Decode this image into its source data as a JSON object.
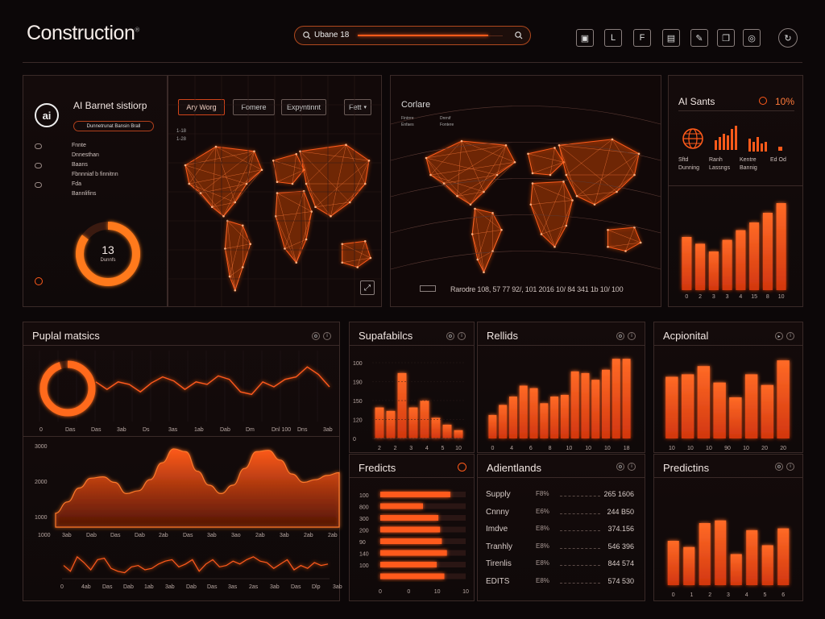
{
  "app": {
    "title": "Construction",
    "title_mark": "®",
    "search_value": "Ubane 18",
    "colors": {
      "accent": "#ff5a1a",
      "bg": "#0c0708",
      "panel_border": "#3a2a28"
    },
    "toolbar_icons": [
      "document-icon",
      "corner-icon",
      "grid-icon",
      "download-icon",
      "pen-icon",
      "copy-icon",
      "search-circle-icon",
      "refresh-icon"
    ]
  },
  "sidebar": {
    "title": "AI Barnet sistiorp",
    "badge": "Dunnetrunat Bansin Brall",
    "items": [
      {
        "label": "Fnnte",
        "icon": "play-icon"
      },
      {
        "label": "Dnnesthan",
        "icon": "none"
      },
      {
        "label": "Baans",
        "icon": "link-icon"
      },
      {
        "label": "Fbnnniaf b finnitnn",
        "icon": "none"
      },
      {
        "label": "Fda",
        "icon": "link-icon"
      },
      {
        "label": "Bannlifins",
        "icon": "none"
      }
    ],
    "donut_value": "13",
    "donut_sub": "Dunnfs",
    "donut_fraction": 0.85
  },
  "map_left": {
    "tabs": [
      "Ary Worg",
      "Fomere",
      "Expyntinnt",
      "Fett"
    ],
    "legend": [
      "1-18",
      "1-28"
    ]
  },
  "map_center": {
    "title": "Corlare",
    "legend": [
      "Fintnre",
      "Dnrnif",
      "Enfaes",
      "Fontere"
    ],
    "footer": "Rarodre 108, 57 77 92/, 101 2016 10/ 84 341 1b 10/ 100"
  },
  "ai_stats": {
    "title": "AI Sants",
    "percent": "10%",
    "stats": [
      {
        "label": "Sftd Dunning",
        "icon": "globe-icon"
      },
      {
        "label": "Ranh Lassngs",
        "icon": "bars-icon"
      },
      {
        "label": "Kentre Bannig",
        "icon": "bars-icon"
      },
      {
        "label": "Ed Od",
        "icon": "bars-icon"
      }
    ],
    "chart_data": {
      "type": "bar",
      "categories": [
        "0",
        "2",
        "3",
        "3",
        "4",
        "15",
        "8",
        "10"
      ],
      "values": [
        55,
        48,
        40,
        52,
        62,
        70,
        80,
        90
      ],
      "ylim": [
        0,
        100
      ],
      "xlabel": "",
      "ylabel": ""
    }
  },
  "pupial": {
    "title": "Puplal matsics",
    "donut_fraction": 0.95,
    "top_ticks": [
      "0",
      "Das",
      "Das",
      "3ab",
      "Ds",
      "3as",
      "1ab",
      "Dab",
      "Dm",
      "Dnl 100",
      "Dns",
      "3ab"
    ],
    "top_line": [
      60,
      45,
      60,
      55,
      40,
      58,
      70,
      62,
      45,
      60,
      55,
      72,
      65,
      40,
      35,
      60,
      50,
      65,
      70,
      90,
      75,
      50
    ],
    "area_y_ticks": [
      "3000",
      "2000",
      "1000"
    ],
    "area_ticks": [
      "1000",
      "3ab",
      "Dab",
      "Das",
      "Dab",
      "2ab",
      "Das",
      "3ab",
      "3ao",
      "2ab",
      "3ab",
      "2ab",
      "2ab"
    ],
    "chart_data": {
      "type": "area",
      "x": [
        0,
        1,
        2,
        3,
        4,
        5,
        6,
        7,
        8,
        9,
        10,
        11,
        12,
        13,
        14,
        15,
        16,
        17,
        18,
        19,
        20,
        21,
        22,
        23,
        24
      ],
      "values": [
        500,
        900,
        1400,
        1750,
        1800,
        1600,
        1200,
        1300,
        1700,
        2300,
        2800,
        2700,
        2000,
        1500,
        1200,
        1500,
        2100,
        2700,
        2750,
        2400,
        1900,
        1600,
        1700,
        1850,
        1950
      ],
      "ylim": [
        0,
        3000
      ],
      "xlabel": "",
      "ylabel": ""
    },
    "bottom_line": [
      40,
      20,
      70,
      50,
      25,
      60,
      65,
      30,
      20,
      15,
      35,
      40,
      25,
      30,
      45,
      55,
      60,
      35,
      45,
      60,
      20,
      45,
      60,
      35,
      40,
      55,
      45,
      60,
      70,
      55,
      50,
      30,
      45,
      60,
      25,
      40,
      30,
      50,
      40,
      45
    ],
    "bottom_ticks": [
      "0",
      "4ab",
      "Das",
      "Dab",
      "1ab",
      "3ab",
      "Dab",
      "Das",
      "3as",
      "2as",
      "3ab",
      "Das",
      "Dlp",
      "3ab"
    ]
  },
  "supafabits": {
    "title": "Supafabilcs",
    "y_ticks": [
      "100",
      "190",
      "150",
      "120",
      "0"
    ],
    "chart_data": {
      "type": "bar",
      "categories": [
        "2",
        "2",
        "3",
        "3",
        "4",
        "5",
        "10"
      ],
      "values": [
        45,
        40,
        95,
        45,
        55,
        30,
        20,
        12
      ],
      "ylim": [
        0,
        110
      ],
      "xlabel": "",
      "ylabel": ""
    },
    "x_labels": [
      "2",
      "2",
      "3",
      "4",
      "5",
      "10"
    ]
  },
  "rellids": {
    "title": "Rellids",
    "chart_data": {
      "type": "bar",
      "categories": [
        "0",
        "4",
        "6",
        "8",
        "10",
        "10",
        "10",
        "18"
      ],
      "values": [
        28,
        40,
        50,
        63,
        60,
        42,
        50,
        52,
        80,
        78,
        70,
        82,
        95,
        95
      ],
      "ylim": [
        0,
        100
      ],
      "xlabel": "",
      "ylabel": ""
    },
    "x_labels": [
      "0",
      "4",
      "6",
      "8",
      "10",
      "10",
      "10",
      "18"
    ]
  },
  "acpionital": {
    "title": "Acpionital",
    "chart_data": {
      "type": "bar",
      "categories": [
        "10",
        "10",
        "10",
        "90",
        "10",
        "20",
        "30"
      ],
      "values": [
        75,
        78,
        88,
        68,
        50,
        78,
        65,
        95
      ],
      "ylim": [
        0,
        100
      ],
      "xlabel": "",
      "ylabel": ""
    },
    "x_labels": [
      "10",
      "10",
      "10",
      "90",
      "10",
      "20",
      "20"
    ]
  },
  "fredicts": {
    "title": "Fredicts",
    "rows": [
      "100",
      "800",
      "300",
      "200",
      "90",
      "140",
      "100"
    ],
    "chart_data": {
      "type": "bar",
      "categories": [
        "100",
        "800",
        "300",
        "200",
        "90",
        "140",
        "100"
      ],
      "values": [
        0.82,
        0.5,
        0.68,
        0.7,
        0.72,
        0.78,
        0.66,
        0.75
      ],
      "xlim": [
        0,
        1
      ],
      "xlabel": "",
      "ylabel": ""
    },
    "x_labels": [
      "0",
      "0",
      "10",
      "10"
    ]
  },
  "adientlands": {
    "title": "Adientlands",
    "rows": [
      {
        "name": "Supply",
        "mid": "F8%",
        "value": "265 1606"
      },
      {
        "name": "Cnnny",
        "mid": "E6%",
        "value": "244 B50"
      },
      {
        "name": "Imdve",
        "mid": "E8%",
        "value": "374.156"
      },
      {
        "name": "Tranhly",
        "mid": "E8%",
        "value": "546 396"
      },
      {
        "name": "Tirenlis",
        "mid": "E8%",
        "value": "844 574"
      },
      {
        "name": "EDITS",
        "mid": "E8%",
        "value": "574 530"
      }
    ]
  },
  "predictins": {
    "title": "Predictins",
    "chart_data": {
      "type": "bar",
      "categories": [
        "0",
        "1",
        "2",
        "3",
        "4",
        "5",
        "6"
      ],
      "values": [
        50,
        43,
        70,
        73,
        35,
        62,
        45,
        64
      ],
      "ylim": [
        0,
        100
      ],
      "xlabel": "",
      "ylabel": ""
    },
    "x_labels": [
      "0",
      "1",
      "2",
      "3",
      "4",
      "5",
      "6"
    ]
  }
}
